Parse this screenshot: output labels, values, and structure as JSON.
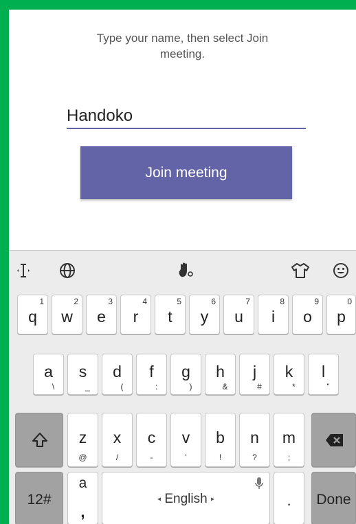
{
  "join": {
    "instruction_lines": [
      "Type your name, then select Join",
      "meeting."
    ],
    "name_value": "Handoko",
    "join_button_label": "Join meeting"
  },
  "keyboard": {
    "toolbar_icons": [
      "cursor-icon",
      "globe-icon",
      "gesture-icon",
      "theme-shirt-icon",
      "emoji-icon"
    ],
    "row1": [
      {
        "key": "q",
        "hint": "1"
      },
      {
        "key": "w",
        "hint": "2"
      },
      {
        "key": "e",
        "hint": "3"
      },
      {
        "key": "r",
        "hint": "4"
      },
      {
        "key": "t",
        "hint": "5"
      },
      {
        "key": "y",
        "hint": "6"
      },
      {
        "key": "u",
        "hint": "7"
      },
      {
        "key": "i",
        "hint": "8"
      },
      {
        "key": "o",
        "hint": "9"
      },
      {
        "key": "p",
        "hint": "0"
      }
    ],
    "row2": [
      {
        "key": "a",
        "hint": "\\"
      },
      {
        "key": "s",
        "hint": "_"
      },
      {
        "key": "d",
        "hint": "("
      },
      {
        "key": "f",
        "hint": ":"
      },
      {
        "key": "g",
        "hint": ")"
      },
      {
        "key": "h",
        "hint": "&"
      },
      {
        "key": "j",
        "hint": "#"
      },
      {
        "key": "k",
        "hint": "*"
      },
      {
        "key": "l",
        "hint": "\""
      }
    ],
    "row3": [
      {
        "key": "z",
        "hint": "@"
      },
      {
        "key": "x",
        "hint": "/"
      },
      {
        "key": "c",
        "hint": "-"
      },
      {
        "key": "v",
        "hint": "'"
      },
      {
        "key": "b",
        "hint": "!"
      },
      {
        "key": "n",
        "hint": "?"
      },
      {
        "key": "m",
        "hint": ";"
      }
    ],
    "numbers_label": "12#",
    "comma_key_main": "a",
    "comma_key_hint": ",",
    "space_label": "English",
    "period_label": ".",
    "done_label": "Done"
  },
  "colors": {
    "frame_border": "#00b050",
    "accent": "#6264a7"
  }
}
